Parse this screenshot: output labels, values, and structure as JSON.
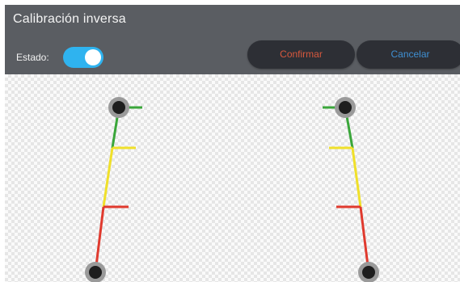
{
  "header": {
    "title": "Calibración inversa",
    "estado_label": "Estado:",
    "toggle_on": true,
    "confirm_label": "Confirmar",
    "cancel_label": "Cancelar"
  },
  "colors": {
    "header_bg": "#5a5d62",
    "toggle_on": "#2fb3ef",
    "confirm_text": "#d7583d",
    "cancel_text": "#3f8fd2",
    "zone_green": "#3aa63a",
    "zone_yellow": "#f0e02a",
    "zone_red": "#e03a2e",
    "handle_ring": "#9a9a9a",
    "handle_core": "#1e1e1e"
  },
  "guides": {
    "zones": [
      "green",
      "yellow",
      "red"
    ],
    "handles": [
      "top-left",
      "bottom-left",
      "top-right",
      "bottom-right"
    ]
  }
}
